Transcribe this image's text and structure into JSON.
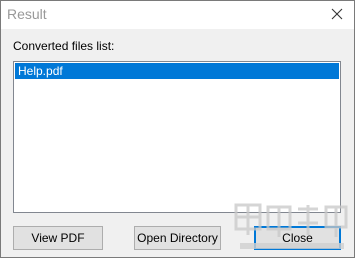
{
  "window": {
    "title": "Result",
    "close_icon": "close-icon"
  },
  "content": {
    "list_label": "Converted files list:",
    "files": [
      "Help.pdf"
    ],
    "selected_index": 0
  },
  "buttons": {
    "view_pdf": "View PDF",
    "open_directory": "Open Directory",
    "close": "Close"
  },
  "colors": {
    "selection": "#0078d7",
    "face": "#f0f0f0",
    "title_text": "#999999"
  },
  "watermark": {
    "icon": "site-logo-watermark"
  }
}
